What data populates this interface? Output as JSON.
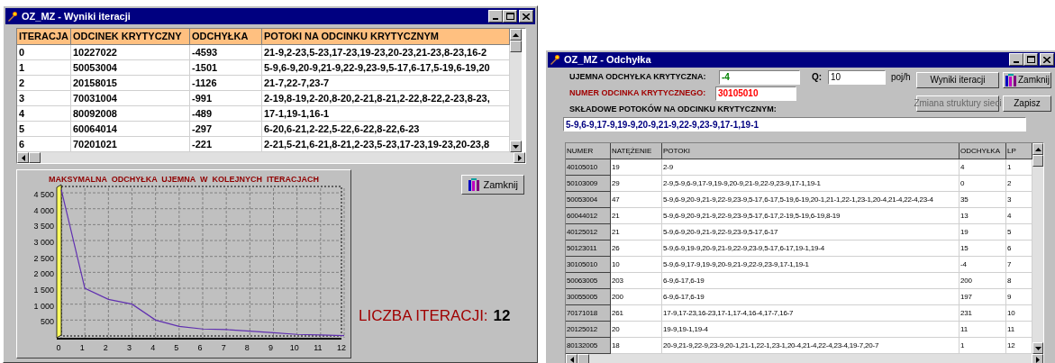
{
  "iterations_window": {
    "title": "OZ_MZ - Wyniki iteracji",
    "table": {
      "columns": [
        "ITERACJA",
        "ODCINEK KRYTYCZNY",
        "ODCHYŁKA",
        "POTOKI NA ODCINKU KRYTYCZNYM"
      ],
      "rows": [
        [
          "0",
          "10227022",
          "-4593",
          "21-9,2-23,5-23,17-23,19-23,20-23,21-23,8-23,16-2"
        ],
        [
          "1",
          "50053004",
          "-1501",
          "5-9,6-9,20-9,21-9,22-9,23-9,5-17,6-17,5-19,6-19,20"
        ],
        [
          "2",
          "20158015",
          "-1126",
          "21-7,22-7,23-7"
        ],
        [
          "3",
          "70031004",
          "-991",
          "2-19,8-19,2-20,8-20,2-21,8-21,2-22,8-22,2-23,8-23,"
        ],
        [
          "4",
          "80092008",
          "-489",
          "17-1,19-1,16-1"
        ],
        [
          "5",
          "60064014",
          "-297",
          "6-20,6-21,2-22,5-22,6-22,8-22,6-23"
        ],
        [
          "6",
          "70201021",
          "-221",
          "2-21,5-21,6-21,8-21,2-23,5-23,17-23,19-23,20-23,8"
        ]
      ]
    },
    "chart_data": {
      "type": "line",
      "title": "MAKSYMALNA  ODCHYŁKA  UJEMNA  W  KOLEJNYCH  ITERACJACH",
      "x": [
        0,
        1,
        2,
        3,
        4,
        5,
        6,
        7,
        8,
        9,
        10,
        11,
        12
      ],
      "series": [
        {
          "color": "#6030b0",
          "values": [
            4600,
            1500,
            1150,
            1000,
            500,
            300,
            220,
            200,
            150,
            100,
            50,
            30,
            10
          ]
        }
      ],
      "grid": true,
      "xlim": [
        0,
        12
      ],
      "ylim": [
        0,
        4700
      ],
      "xticks": [
        0,
        1,
        2,
        3,
        4,
        5,
        6,
        7,
        8,
        9,
        10,
        11,
        12
      ],
      "yticks": [
        {
          "value": 500,
          "label": "500"
        },
        {
          "value": 1000,
          "label": "1 000"
        },
        {
          "value": 1500,
          "label": "1 500"
        },
        {
          "value": 2000,
          "label": "2 000"
        },
        {
          "value": 2500,
          "label": "2 500"
        },
        {
          "value": 3000,
          "label": "3 000"
        },
        {
          "value": 3500,
          "label": "3 500"
        },
        {
          "value": 4000,
          "label": "4 000"
        },
        {
          "value": 4500,
          "label": "4 500"
        }
      ]
    },
    "close_button": "Zamknij",
    "iterations_label": "LICZBA ITERACJI:",
    "iterations_value": "12"
  },
  "deviation_window": {
    "title": "OZ_MZ - Odchyłka",
    "negative_deviation_label": "UJEMNA ODCHYŁKA KRYTYCZNA:",
    "negative_deviation_value": "-4",
    "q_label": "Q:",
    "q_value": "10",
    "q_unit": "poj/h",
    "segment_label": "NUMER ODCINKA KRYTYCZNEGO:",
    "segment_value": "30105010",
    "buttons": [
      {
        "label": "Wyniki iteracji",
        "disabled": false,
        "icon": false
      },
      {
        "label": "Zamknij",
        "disabled": false,
        "icon": true
      },
      {
        "label": "Zmiana struktury sieci",
        "disabled": true,
        "icon": false
      },
      {
        "label": "Zapisz",
        "disabled": false,
        "icon": false
      }
    ],
    "flows_label": "SKŁADOWE POTOKÓW NA ODCINKU KRYTYCZNYM:",
    "flows_value": "5-9,6-9,17-9,19-9,20-9,21-9,22-9,23-9,17-1,19-1",
    "table": {
      "columns": [
        "NUMER",
        "NATĘŻENIE",
        "POTOKI",
        "ODCHYŁKA",
        "LP"
      ],
      "rows": [
        [
          "40105010",
          "19",
          "2-9",
          "4",
          "1"
        ],
        [
          "50103009",
          "29",
          "2-9,5-9,6-9,17-9,19-9,20-9,21-9,22-9,23-9,17-1,19-1",
          "0",
          "2"
        ],
        [
          "50053004",
          "47",
          "5-9,6-9,20-9,21-9,22-9,23-9,5-17,6-17,5-19,6-19,20-1,21-1,22-1,23-1,20-4,21-4,22-4,23-4",
          "35",
          "3"
        ],
        [
          "60044012",
          "21",
          "5-9,6-9,20-9,21-9,22-9,23-9,5-17,6-17,2-19,5-19,6-19,8-19",
          "13",
          "4"
        ],
        [
          "40125012",
          "21",
          "5-9,6-9,20-9,21-9,22-9,23-9,5-17,6-17",
          "19",
          "5"
        ],
        [
          "50123011",
          "26",
          "5-9,6-9,19-9,20-9,21-9,22-9,23-9,5-17,6-17,19-1,19-4",
          "15",
          "6"
        ],
        [
          "30105010",
          "10",
          "5-9,6-9,17-9,19-9,20-9,21-9,22-9,23-9,17-1,19-1",
          "-4",
          "7"
        ],
        [
          "50063005",
          "203",
          "6-9,6-17,6-19",
          "200",
          "8"
        ],
        [
          "30055005",
          "200",
          "6-9,6-17,6-19",
          "197",
          "9"
        ],
        [
          "70171018",
          "261",
          "17-9,17-23,16-23,17-1,17-4,16-4,17-7,16-7",
          "231",
          "10"
        ],
        [
          "20125012",
          "20",
          "19-9,19-1,19-4",
          "11",
          "11"
        ],
        [
          "80132005",
          "18",
          "20-9,21-9,22-9,23-9,20-1,21-1,22-1,23-1,20-4,21-4,22-4,23-4,19-7,20-7",
          "1",
          "12"
        ]
      ]
    }
  }
}
